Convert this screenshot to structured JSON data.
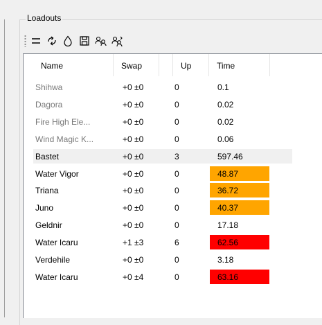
{
  "group": {
    "title": "Loadouts"
  },
  "toolbar": {
    "buttons": [
      {
        "icon": "menu-icon"
      },
      {
        "icon": "refresh-icon"
      },
      {
        "icon": "drop-icon"
      },
      {
        "icon": "save-icon"
      },
      {
        "icon": "load-loadout-icon"
      },
      {
        "icon": "load-loadout-alt-icon"
      }
    ]
  },
  "table": {
    "columns": [
      "Name",
      "Swap",
      "Up",
      "Time"
    ],
    "rows": [
      {
        "name": "Shihwa",
        "swap": "+0 ±0",
        "up": "0",
        "time": "0.1",
        "dim": true,
        "highlight": ""
      },
      {
        "name": "Dagora",
        "swap": "+0 ±0",
        "up": "0",
        "time": "0.02",
        "dim": true,
        "highlight": ""
      },
      {
        "name": "Fire High Ele...",
        "swap": "+0 ±0",
        "up": "0",
        "time": "0.02",
        "dim": true,
        "highlight": ""
      },
      {
        "name": "Wind Magic K...",
        "swap": "+0 ±0",
        "up": "0",
        "time": "0.06",
        "dim": true,
        "highlight": ""
      },
      {
        "name": "Bastet",
        "swap": "+0 ±0",
        "up": "3",
        "time": "597.46",
        "dim": false,
        "highlight": "",
        "selected": true
      },
      {
        "name": "Water Vigor",
        "swap": "+0 ±0",
        "up": "0",
        "time": "48.87",
        "dim": false,
        "highlight": "#ffa500"
      },
      {
        "name": "Triana",
        "swap": "+0 ±0",
        "up": "0",
        "time": "36.72",
        "dim": false,
        "highlight": "#ffa500"
      },
      {
        "name": "Juno",
        "swap": "+0 ±0",
        "up": "0",
        "time": "40.37",
        "dim": false,
        "highlight": "#ffa500"
      },
      {
        "name": "Geldnir",
        "swap": "+0 ±0",
        "up": "0",
        "time": "17.18",
        "dim": false,
        "highlight": ""
      },
      {
        "name": "Water Icaru",
        "swap": "+1 ±3",
        "up": "6",
        "time": "62.56",
        "dim": false,
        "highlight": "#ff0000"
      },
      {
        "name": "Verdehile",
        "swap": "+0 ±0",
        "up": "0",
        "time": "3.18",
        "dim": false,
        "highlight": ""
      },
      {
        "name": "Water Icaru",
        "swap": "+0 ±4",
        "up": "0",
        "time": "63.16",
        "dim": false,
        "highlight": "#ff0000"
      }
    ]
  }
}
